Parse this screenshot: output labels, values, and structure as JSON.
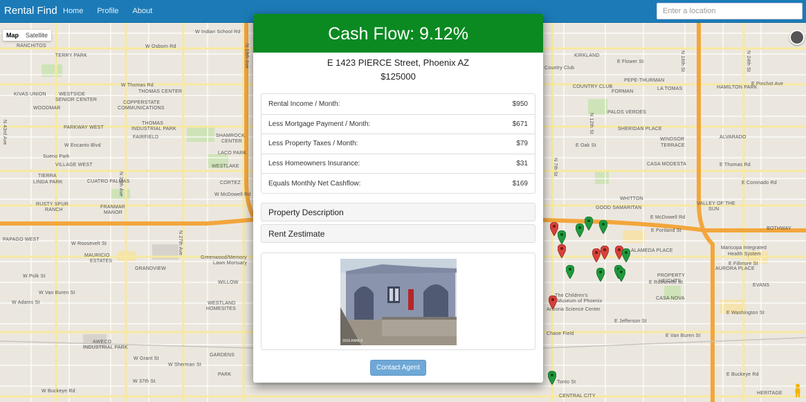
{
  "navbar": {
    "brand": "Rental Find",
    "links": [
      "Home",
      "Profile",
      "About"
    ],
    "search_placeholder": "Enter a location"
  },
  "map": {
    "map_type": [
      "Map",
      "Satellite"
    ],
    "labels": {
      "ranchitos": "RANCHITOS",
      "terry_park": "TERRY PARK",
      "kivas": "KIVAS UNION",
      "westside": "WESTSIDE",
      "senior_center": "SENIOR CENTER",
      "woodmar": "WOODMAR",
      "parkway_west": "PARKWAY WEST",
      "suenopark": "Sueno Park",
      "village_west": "VILLAGE WEST",
      "tierra": "TIERRA",
      "linda": "LINDA PARK",
      "cuatro_palmas": "CUATRO PALMAS",
      "rusty_spur": "RUSTY SPUR",
      "ranch": "RANCH",
      "franmar": "FRANMAR",
      "manor": "MANOR",
      "papago_west": "PAPAGO WEST",
      "mauricio": "MAURICIO",
      "estates": "ESTATES",
      "grandview": "GRANDVIEW",
      "willow": "WILLOW",
      "westland": "WESTLAND",
      "homesites": "HOMESITES",
      "aweco": "AWECO",
      "industrial_park": "INDUSTRIAL PARK",
      "gardens": "GARDENS",
      "park": "PARK",
      "copperstate": "COPPERSTATE",
      "communications": "COMMUNICATIONS",
      "thomas_center": "THOMAS CENTER",
      "thomas_industrial": "THOMAS",
      "industrial_park2": "INDUSTRIAL PARK",
      "fairfield": "FAIRFIELD",
      "shamrock": "SHAMROCK",
      "center": "CENTER",
      "lacopark": "LACO PARK",
      "westlake": "WESTLAKE",
      "cortez": "CORTEZ",
      "greenwood": "Greenwood/Memory",
      "lawn": "Lawn Mortuary",
      "kirkland": "KIRKLAND",
      "country_club": "Country Club",
      "country_club2": "COUNTRY CLUB",
      "pepe": "PEPE-THURMAN",
      "forman": "FORMAN",
      "la_tomas": "LA TOMAS",
      "hamilton": "HAMILTON PARK",
      "palos_verdes": "PALOS VERDES",
      "sheridan": "SHERIDAN PLACE",
      "alvarado": "ALVARADO",
      "windsor": "WINDSOR",
      "terrace": "TERRACE",
      "casa_modesta": "CASA MODESTA",
      "good_samaritan": "GOOD SAMARITAN",
      "whitton": "WHITTON",
      "valley": "VALLEY OF THE",
      "sun": "SUN",
      "bothway": "BOTHWAY",
      "alameda": "ALAMEDA PLACE",
      "maricopa": "Maricopa Integrated",
      "health": "Health System",
      "property_heights": "PROPERTY",
      "heights": "HEIGHTS",
      "aurora": "AURORA PLACE",
      "evans": "EVANS",
      "casa_nova": "CASA NOVA",
      "childrens": "The Children's",
      "museum": "Museum of Phoenix",
      "arizona_sci": "Arizona Science Center",
      "chase_field": "Chase Field",
      "central_city": "CENTRAL CITY",
      "heritage": "HERITAGE",
      "tonto": "Tonto St",
      "w_encanto": "W Encanto Blvd",
      "w_indian": "W Indian School Rd",
      "w_osborn": "W Osborn Rd",
      "w_thomas": "W Thomas Rd",
      "w_mcdowell": "W McDowell Rd",
      "w_roosevelt": "W Roosevelt St",
      "w_vanburen": "W Van Buren St",
      "w_adams": "W Adams St",
      "w_buckeye": "W Buckeye Rd",
      "w_polk": "W Polk St",
      "w_grant": "W Grant St",
      "w_sherman": "W Sherman St",
      "w_37th": "W 37th St",
      "e_mcdowell": "E McDowell Rd",
      "e_thomas": "E Thomas Rd",
      "e_roosevelt": "E Roosevelt St",
      "e_vanburen": "E Van Buren St",
      "e_jefferson": "E Jefferson St",
      "e_buckeye": "E Buckeye Rd",
      "e_washington": "E Washington St",
      "e_portland": "E Portland St",
      "e_fillmore": "E Fillmore St",
      "e_oak": "E Oak St",
      "e_coronado": "E Coronado Rd",
      "e_pinchot": "E Pinchot Ave",
      "e_flower": "E Flower St",
      "n_43rd": "N 43rd Ave",
      "n_35th": "N 35th Ave",
      "n_27th": "N 27th Ave",
      "n_19th": "N 19th Ave",
      "n_7th": "N 7th St",
      "n_16th": "N 16th St",
      "n_24th": "N 24th St",
      "n_12th": "N 12th St"
    }
  },
  "modal": {
    "header": "Cash Flow: 9.12%",
    "address": "E 1423 PIERCE Street, Phoenix AZ",
    "price": "$125000",
    "rows": [
      {
        "label": "Rental Income / Month:",
        "value": "$950"
      },
      {
        "label": "Less Mortgage Payment / Month:",
        "value": "$671"
      },
      {
        "label": "Less Property Taxes / Month:",
        "value": "$79"
      },
      {
        "label": "Less Homeowners Insurance:",
        "value": "$31"
      },
      {
        "label": "Equals Monthly Net Cashflow:",
        "value": "$169"
      }
    ],
    "panels": [
      "Property Description",
      "Rent Zestimate"
    ],
    "photo_watermark": "2016 ARMLS",
    "contact_label": "Contact Agent"
  },
  "colors": {
    "navbar": "#1c7bb7",
    "cashflow_green": "#0a8a21",
    "contact_button": "#6fa8d6",
    "pin_red": "#d9413a",
    "pin_green": "#1f9a3c",
    "freeway": "#f2a63c"
  }
}
